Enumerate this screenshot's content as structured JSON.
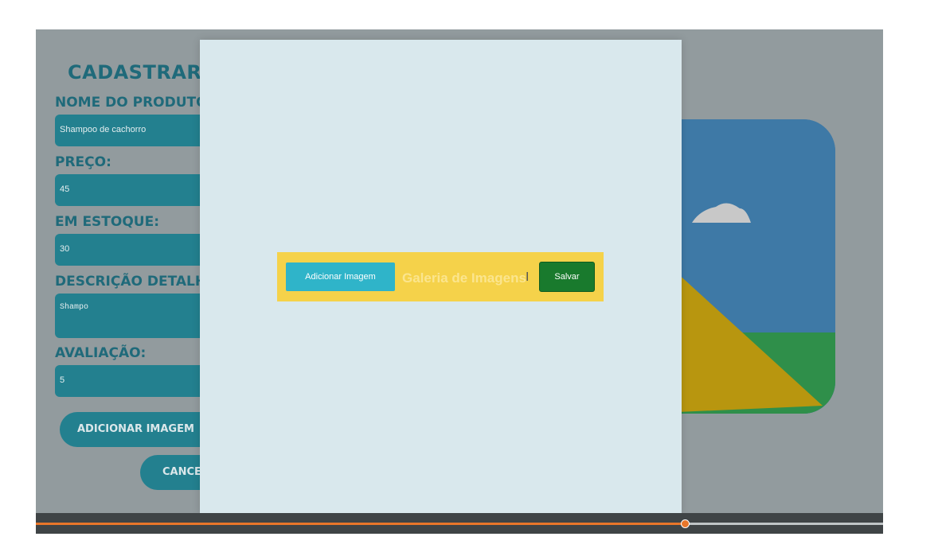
{
  "form": {
    "title": "CADASTRAR",
    "product_name_label": "NOME DO PRODUTO:",
    "product_name_value": "Shampoo de cachorro",
    "price_label": "PREÇO:",
    "price_value": "45",
    "stock_label": "EM ESTOQUE:",
    "stock_value": "30",
    "description_label": "DESCRIÇÃO DETALHADA:",
    "description_value": "Shampo",
    "rating_label": "AVALIAÇÃO:",
    "rating_value": "5",
    "add_image_label": "ADICIONAR IMAGEM",
    "cancel_label": "CANCELAR"
  },
  "illustration": {
    "icon": "image-placeholder-icon",
    "sky": "#3e79a6",
    "hill": "#b8960f",
    "grass": "#2f8f4a",
    "cloud": "#c8c8c8"
  },
  "modal": {
    "add_image_button": "Adicionar Imagem",
    "gallery_title": "Galeria de Imagens",
    "save_button": "Salvar",
    "bar_color": "#f5d24a",
    "add_button_color": "#2fb4c9",
    "save_button_color": "#197a2d"
  },
  "player": {
    "progress": 0.766,
    "accent": "#e8762a"
  }
}
